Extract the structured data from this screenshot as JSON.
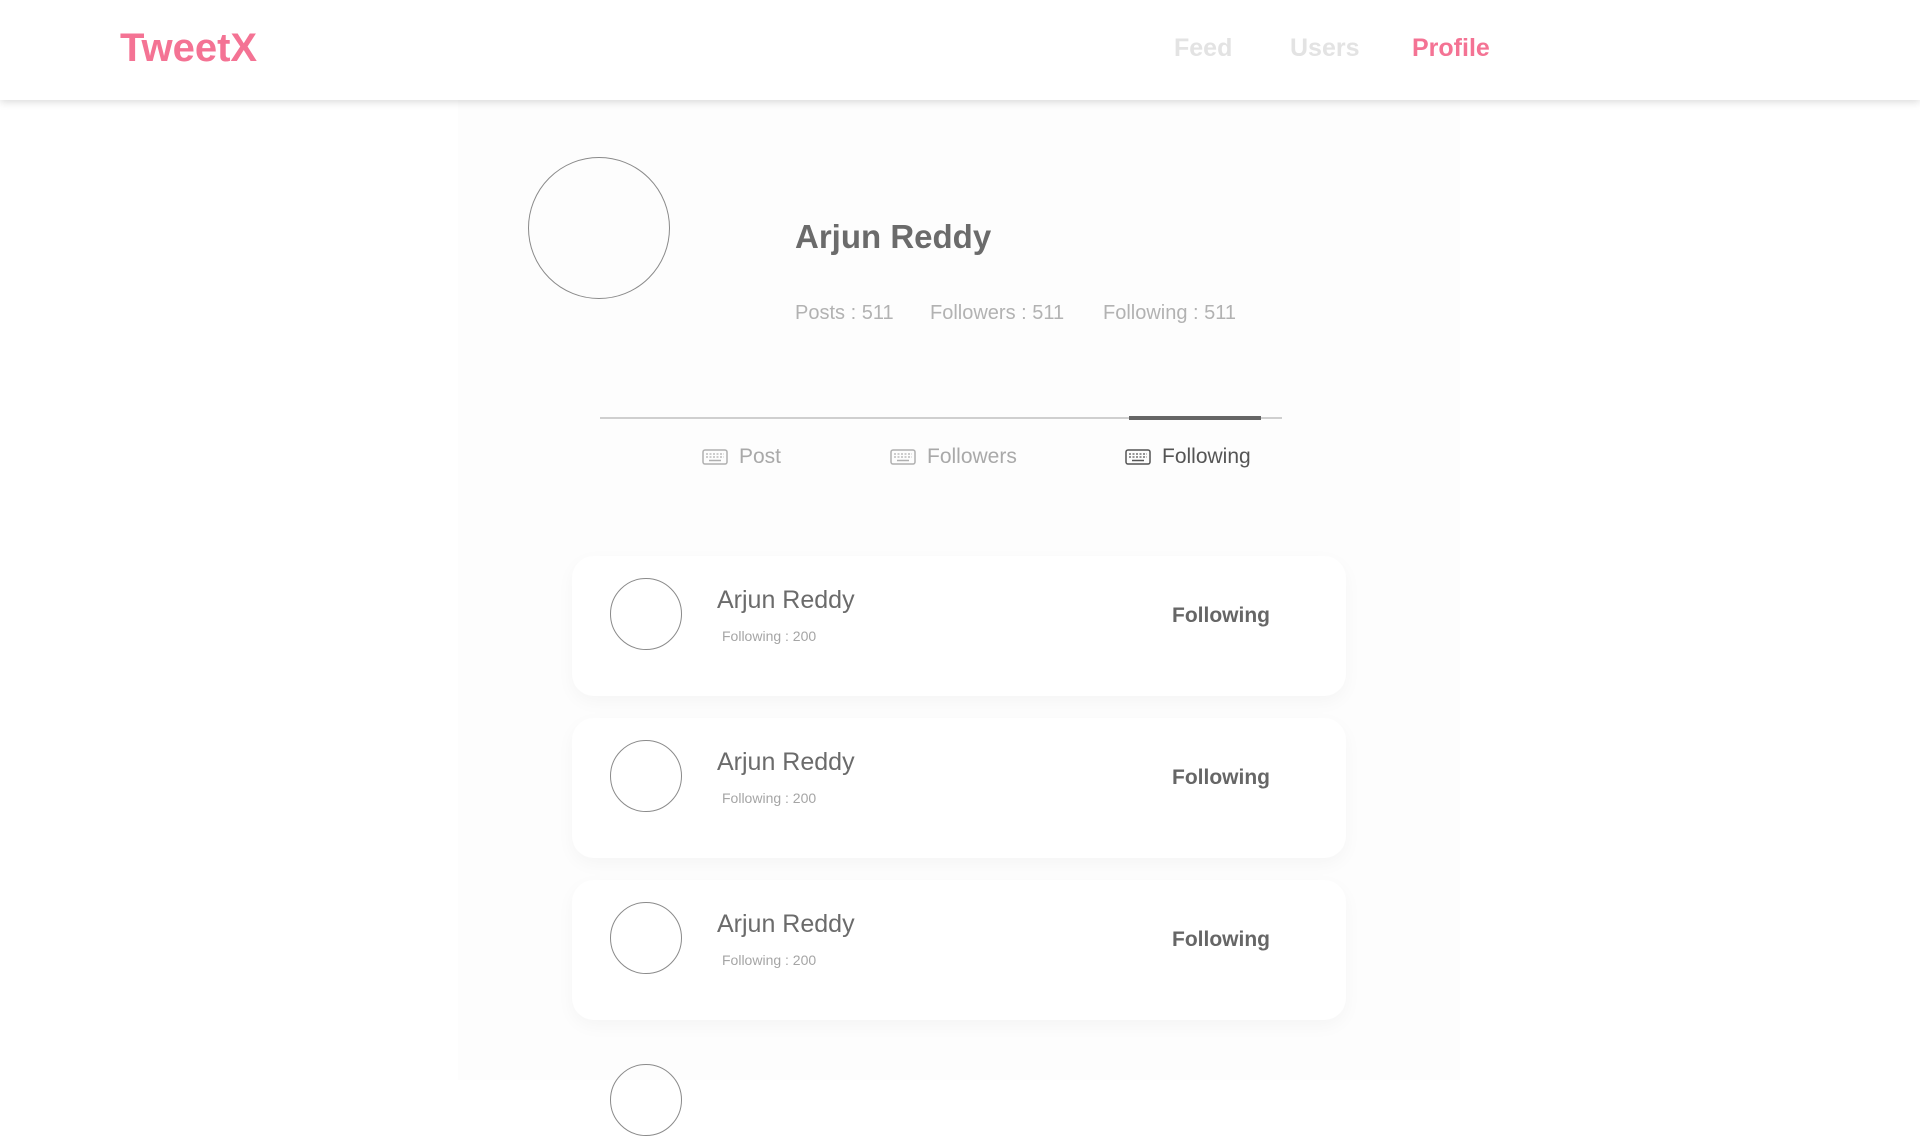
{
  "app": {
    "brand": "TweetX",
    "brand_color": "#f47394"
  },
  "nav": {
    "feed": "Feed",
    "users": "Users",
    "profile": "Profile",
    "active": "Profile"
  },
  "profile": {
    "name": "Arjun Reddy",
    "stats": {
      "posts": "Posts : 511",
      "followers": "Followers : 511",
      "following": "Following : 511"
    }
  },
  "tabs": {
    "post": "Post",
    "followers": "Followers",
    "following": "Following",
    "active": "Following"
  },
  "following_list": [
    {
      "name": "Arjun Reddy",
      "sub": "Following : 200",
      "action": "Following"
    },
    {
      "name": "Arjun Reddy",
      "sub": "Following : 200",
      "action": "Following"
    },
    {
      "name": "Arjun Reddy",
      "sub": "Following : 200",
      "action": "Following"
    }
  ]
}
